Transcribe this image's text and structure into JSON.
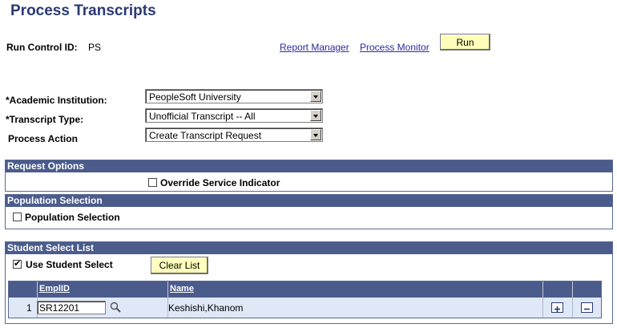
{
  "page": {
    "title": "Process Transcripts"
  },
  "run_control": {
    "label": "Run Control ID:",
    "value": "PS",
    "report_manager": "Report Manager",
    "process_monitor": "Process Monitor",
    "run_label": "Run"
  },
  "form": {
    "institution": {
      "label": "*Academic Institution:",
      "value": "PeopleSoft University"
    },
    "transcript_type": {
      "label": "*Transcript Type:",
      "value": "Unofficial Transcript -- All"
    },
    "process_action": {
      "label": "Process Action",
      "value": "Create Transcript Request"
    }
  },
  "request_options": {
    "header": "Request Options",
    "override_label": "Override Service Indicator",
    "override_checked": false
  },
  "population_selection": {
    "header": "Population Selection",
    "checkbox_label": "Population Selection",
    "checked": false
  },
  "student_select": {
    "header": "Student Select List",
    "use_label": "Use Student Select",
    "use_checked": true,
    "clear_label": "Clear List",
    "columns": {
      "emplid": "EmplID",
      "name": "Name"
    },
    "rows": [
      {
        "num": "1",
        "emplid": "SR12201",
        "name": "Keshishi,Khanom"
      }
    ]
  },
  "colors": {
    "title": "#2a3a72",
    "header_bg": "#4a5b8c",
    "button_bg": "#ffffbb",
    "row_bg": "#dfe8f7",
    "link": "#2b2ba0"
  },
  "icons": {
    "lookup": "magnifier-icon",
    "add": "plus-icon",
    "remove": "minus-icon"
  }
}
